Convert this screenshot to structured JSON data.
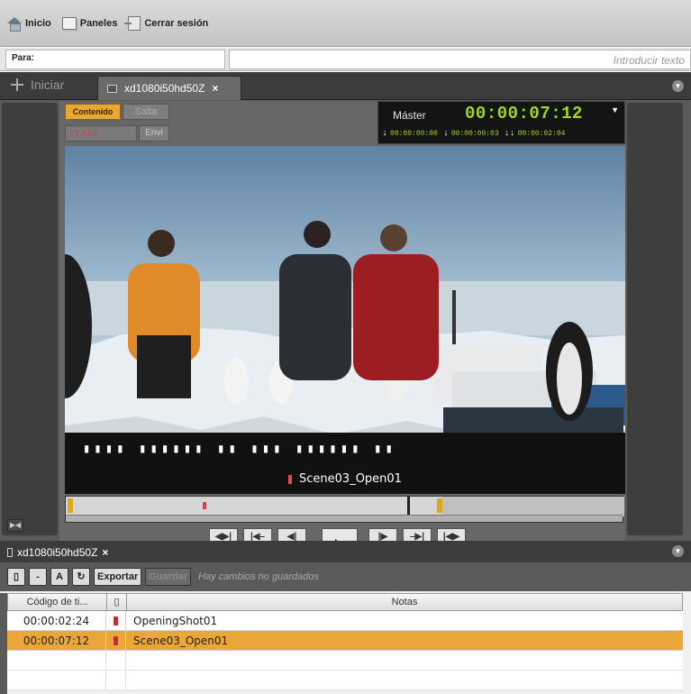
{
  "toolbar": {
    "home_label": "Inicio",
    "panels_label": "Paneles",
    "logout_label": "Cerrar sesión"
  },
  "search": {
    "para_label": "Para:",
    "placeholder": "Introducir texto"
  },
  "editor": {
    "tab_start_label": "Iniciar",
    "tab_active_label": "xd1080i50hd50Z",
    "tab_close_glyph": "×",
    "content_button": "Contenido",
    "skip_button": "Salta",
    "track_label": "V1 A1-2",
    "send_button": "Envi",
    "timecode": {
      "label": "Máster",
      "value": "00:00:07:12",
      "mark_in": "00:00:00:00",
      "mark_out": "00:00:00:03",
      "duration": "00:00:02:04"
    },
    "video_caption": "Scene03_Open01",
    "transport": {
      "row1": [
        "◀▶|",
        "|◀–",
        "◀|",
        "|▶",
        "–▶|",
        "|◀▶"
      ],
      "row2": [
        "◀◀|",
        "◀◀",
        "◀",
        "▶",
        "▶▶",
        "|▶▶"
      ]
    },
    "fit_glyph": "▶◀"
  },
  "markers": {
    "tab_label": "xd1080i50hd50Z",
    "tab_close_glyph": "×",
    "toolbar": {
      "btn_marker": "▯",
      "btn_minus": "-",
      "btn_a": "A",
      "btn_refresh": "↻",
      "export_label": "Exportar",
      "save_label": "Guardar",
      "status": "Hay cambios no guardados"
    },
    "columns": {
      "timecode": "Código de ti...",
      "color": "▯",
      "notes": "Notas"
    },
    "rows": [
      {
        "timecode": "00:00:02:24",
        "notes": "OpeningShot01",
        "selected": false
      },
      {
        "timecode": "00:00:07:12",
        "notes": "Scene03_Open01",
        "selected": true
      }
    ],
    "marker_color": "#c03030"
  },
  "colors": {
    "accent": "#e8a930",
    "timecode_green": "#9fd81d",
    "selection": "#eba63a"
  }
}
